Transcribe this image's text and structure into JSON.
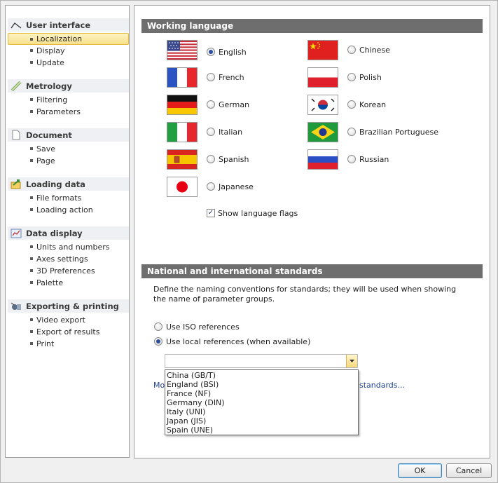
{
  "sidebar": {
    "categories": [
      {
        "label": "User interface",
        "items": [
          "Localization",
          "Display",
          "Update"
        ]
      },
      {
        "label": "Metrology",
        "items": [
          "Filtering",
          "Parameters"
        ]
      },
      {
        "label": "Document",
        "items": [
          "Save",
          "Page"
        ]
      },
      {
        "label": "Loading data",
        "items": [
          "File formats",
          "Loading action"
        ]
      },
      {
        "label": "Data display",
        "items": [
          "Units and numbers",
          "Axes settings",
          "3D Preferences",
          "Palette"
        ]
      },
      {
        "label": "Exporting & printing",
        "items": [
          "Video export",
          "Export of results",
          "Print"
        ]
      }
    ],
    "selected": "Localization"
  },
  "working_language": {
    "title": "Working language",
    "languages": [
      "English",
      "French",
      "German",
      "Italian",
      "Spanish",
      "Japanese",
      "Chinese",
      "Polish",
      "Korean",
      "Brazilian Portuguese",
      "Russian"
    ],
    "selected": "English",
    "show_flags_label": "Show language flags",
    "show_flags_checked": true
  },
  "standards": {
    "title": "National and international standards",
    "description": "Define the naming conventions for standards; they will be used when showing the name of parameter groups.",
    "option_iso": "Use ISO references",
    "option_local": "Use local references (when available)",
    "selected_option": "local",
    "combo_value": "",
    "dropdown_options": [
      "China (GB/T)",
      "England (BSI)",
      "France (NF)",
      "Germany (DIN)",
      "Italy (UNI)",
      "Japan (JIS)",
      "Spain (UNE)"
    ],
    "link_left": "Mo",
    "link_right": "standards..."
  },
  "buttons": {
    "ok": "OK",
    "cancel": "Cancel"
  },
  "colors": {
    "header_bg": "#6e6e6e",
    "selection_bg": "#f8e08a",
    "link": "#1b3f8f"
  }
}
